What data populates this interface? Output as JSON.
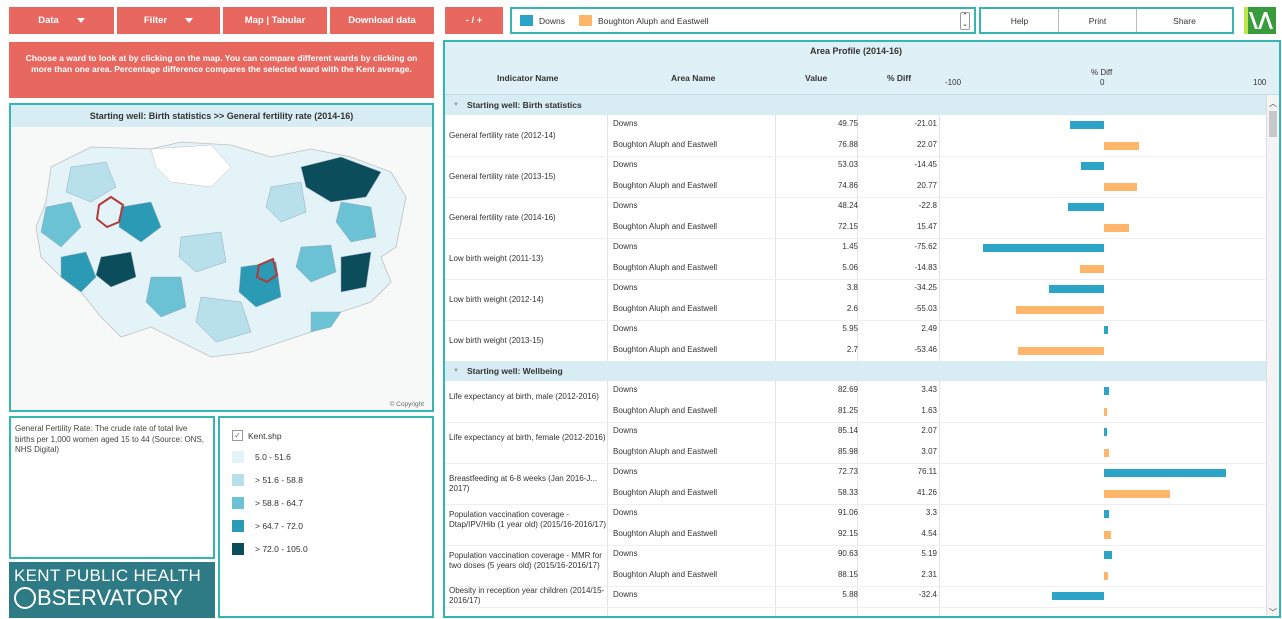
{
  "toolbar": {
    "data_label": "Data",
    "filter_label": "Filter",
    "map_tabular_label": "Map | Tabular",
    "download_label": "Download data",
    "plus_minus_label": "- / +",
    "help_label": "Help",
    "print_label": "Print",
    "share_label": "Share"
  },
  "legend_areas": [
    {
      "name": "Downs",
      "color": "#2ba4c8"
    },
    {
      "name": "Boughton Aluph and Eastwell",
      "color": "#ffb66b"
    }
  ],
  "instructions": "Choose a ward to look at by clicking on the map. You can compare different wards by clicking on more than one area. Percentage difference compares the selected ward with the Kent average.",
  "map": {
    "title": "Starting well:  Birth statistics >>  General fertility rate (2014-16)",
    "copyright": "© Copyright"
  },
  "definition": "General Fertility Rate: The crude rate of total live births per 1,000 women aged 15 to 44 (Source: ONS, NHS Digital)",
  "map_legend": {
    "layer": "Kent.shp",
    "check": "✓",
    "items": [
      {
        "label": "5.0 - 51.6",
        "color": "#e4f3f7"
      },
      {
        "label": "> 51.6 - 58.8",
        "color": "#b7e0ea"
      },
      {
        "label": "> 58.8 - 64.7",
        "color": "#6bc2d4"
      },
      {
        "label": "> 64.7 - 72.0",
        "color": "#2b9ab5"
      },
      {
        "label": "> 72.0 - 105.0",
        "color": "#0c4d5c"
      }
    ]
  },
  "logo": {
    "line1": "KENT PUBLIC HEALTH",
    "line2": "BSERVATORY"
  },
  "profile": {
    "title": "Area Profile (2014-16)",
    "col_indicator": "Indicator Name",
    "col_area": "Area Name",
    "col_value": "Value",
    "col_diff": "% Diff",
    "col_diff_chart": "% Diff",
    "axis_min": "-100",
    "axis_mid": "0",
    "axis_max": "100",
    "sections": [
      {
        "title": "Starting well:  Birth statistics",
        "indicators": [
          {
            "name": "General fertility rate (2012-14)",
            "rows": [
              {
                "area": "Downs",
                "value": "49.75",
                "diff": -21.01,
                "diff_text": "-21.01"
              },
              {
                "area": "Boughton Aluph and Eastwell",
                "value": "76.88",
                "diff": 22.07,
                "diff_text": "22.07"
              }
            ]
          },
          {
            "name": "General fertility rate (2013-15)",
            "rows": [
              {
                "area": "Downs",
                "value": "53.03",
                "diff": -14.45,
                "diff_text": "-14.45"
              },
              {
                "area": "Boughton Aluph and Eastwell",
                "value": "74.86",
                "diff": 20.77,
                "diff_text": "20.77"
              }
            ]
          },
          {
            "name": "General fertility rate (2014-16)",
            "rows": [
              {
                "area": "Downs",
                "value": "48.24",
                "diff": -22.8,
                "diff_text": "-22.8"
              },
              {
                "area": "Boughton Aluph and Eastwell",
                "value": "72.15",
                "diff": 15.47,
                "diff_text": "15.47"
              }
            ]
          },
          {
            "name": "Low birth weight (2011-13)",
            "rows": [
              {
                "area": "Downs",
                "value": "1.45",
                "diff": -75.62,
                "diff_text": "-75.62"
              },
              {
                "area": "Boughton Aluph and Eastwell",
                "value": "5.06",
                "diff": -14.83,
                "diff_text": "-14.83"
              }
            ]
          },
          {
            "name": "Low birth weight (2012-14)",
            "rows": [
              {
                "area": "Downs",
                "value": "3.8",
                "diff": -34.25,
                "diff_text": "-34.25"
              },
              {
                "area": "Boughton Aluph and Eastwell",
                "value": "2.6",
                "diff": -55.03,
                "diff_text": "-55.03"
              }
            ]
          },
          {
            "name": "Low birth weight (2013-15)",
            "rows": [
              {
                "area": "Downs",
                "value": "5.95",
                "diff": 2.49,
                "diff_text": "2.49"
              },
              {
                "area": "Boughton Aluph and Eastwell",
                "value": "2.7",
                "diff": -53.46,
                "diff_text": "-53.46"
              }
            ]
          }
        ]
      },
      {
        "title": "Starting well:  Wellbeing",
        "indicators": [
          {
            "name": "Life expectancy at birth, male (2012-2016)",
            "rows": [
              {
                "area": "Downs",
                "value": "82.69",
                "diff": 3.43,
                "diff_text": "3.43"
              },
              {
                "area": "Boughton Aluph and Eastwell",
                "value": "81.25",
                "diff": 1.63,
                "diff_text": "1.63"
              }
            ]
          },
          {
            "name": "Life expectancy at birth, female (2012-2016)",
            "rows": [
              {
                "area": "Downs",
                "value": "85.14",
                "diff": 2.07,
                "diff_text": "2.07"
              },
              {
                "area": "Boughton Aluph and Eastwell",
                "value": "85.98",
                "diff": 3.07,
                "diff_text": "3.07"
              }
            ]
          },
          {
            "name": "Breastfeeding at 6-8 weeks (Jan 2016-J... 2017)",
            "rows": [
              {
                "area": "Downs",
                "value": "72.73",
                "diff": 76.11,
                "diff_text": "76.11"
              },
              {
                "area": "Boughton Aluph and Eastwell",
                "value": "58.33",
                "diff": 41.26,
                "diff_text": "41.26"
              }
            ]
          },
          {
            "name": "Population vaccination coverage - Dtap/IPV/Hib (1 year old) (2015/16-2016/17)",
            "rows": [
              {
                "area": "Downs",
                "value": "91.06",
                "diff": 3.3,
                "diff_text": "3.3"
              },
              {
                "area": "Boughton Aluph and Eastwell",
                "value": "92.15",
                "diff": 4.54,
                "diff_text": "4.54"
              }
            ]
          },
          {
            "name": "Population vaccination coverage - MMR for two doses (5 years old) (2015/16-2016/17)",
            "rows": [
              {
                "area": "Downs",
                "value": "90.63",
                "diff": 5.19,
                "diff_text": "5.19"
              },
              {
                "area": "Boughton Aluph and Eastwell",
                "value": "88.15",
                "diff": 2.31,
                "diff_text": "2.31"
              }
            ]
          },
          {
            "name": "Obesity in reception year children (2014/15-2016/17)",
            "rows": [
              {
                "area": "Downs",
                "value": "5.88",
                "diff": -32.4,
                "diff_text": "-32.4"
              }
            ]
          }
        ]
      }
    ]
  }
}
